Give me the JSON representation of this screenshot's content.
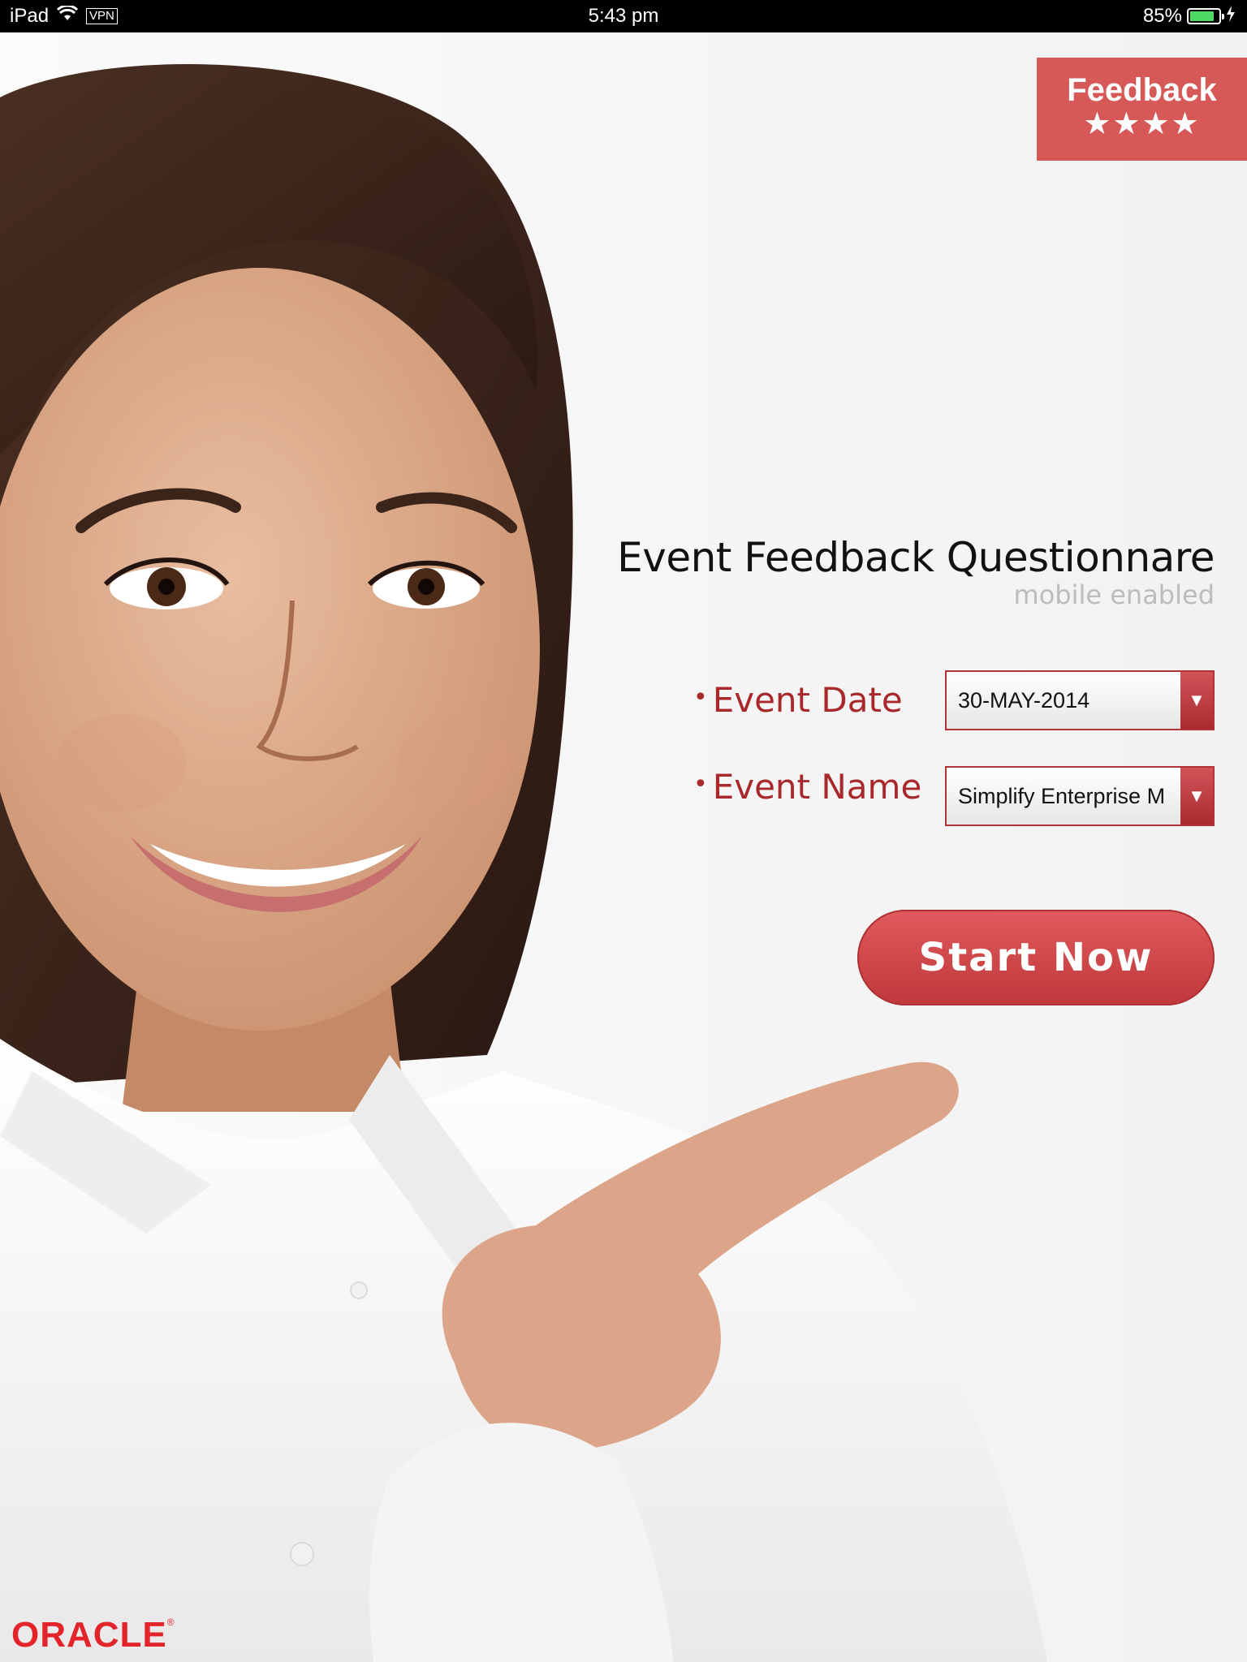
{
  "status_bar": {
    "device": "iPad",
    "vpn": "VPN",
    "time": "5:43 pm",
    "battery_text": "85%",
    "battery_level": 0.85,
    "icons": [
      "wifi-icon",
      "battery-icon",
      "charging-icon"
    ]
  },
  "feedback_badge": {
    "label": "Feedback",
    "stars": "★★★★",
    "star_count": 4,
    "color": "#d65957"
  },
  "header": {
    "title": "Event Feedback Questionnare",
    "subtitle": "mobile enabled"
  },
  "form": {
    "event_date_label": "Event Date",
    "event_date_value": "30-MAY-2014",
    "event_name_label": "Event Name",
    "event_name_value": "Simplify Enterprise M",
    "bullet": "•",
    "dropdown_arrow": "▼"
  },
  "start_button": {
    "label": "Start Now"
  },
  "branding": {
    "logo_text": "ORACLE",
    "registered": "®",
    "accent_color": "#a8282b"
  }
}
